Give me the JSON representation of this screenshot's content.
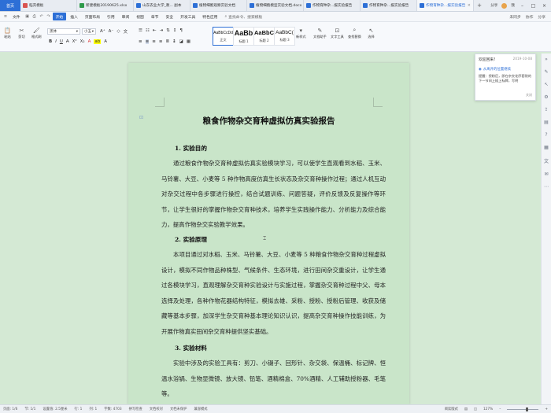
{
  "tabs": {
    "home": "首页",
    "items": [
      {
        "label": "稻壳模板",
        "color": "#d9534f"
      },
      {
        "label": "新建模板20190625.xlsx",
        "color": "#2e9a4a"
      },
      {
        "label": "山东农业大学_教... 副本",
        "color": "#2d6fd6"
      },
      {
        "label": "植物细胞观察实验文档",
        "color": "#2d6fd6"
      },
      {
        "label": "植物细胞模型实验文档.docx",
        "color": "#2d6fd6"
      },
      {
        "label": "作物育种杂...报实验报告",
        "color": "#2d6fd6"
      },
      {
        "label": "作物育种杂...报实验报告",
        "color": "#2d6fd6"
      },
      {
        "label": "作物育种杂...报实验报告",
        "color": "#2d6fd6",
        "active": true
      }
    ],
    "right": [
      "分享",
      "我"
    ]
  },
  "menu": {
    "file": "文件",
    "items": [
      "开始",
      "插入",
      "页面布局",
      "引用",
      "审阅",
      "视图",
      "章节",
      "安全",
      "开发工具",
      "特色应用"
    ],
    "active_index": 0,
    "search": "查找命令、搜索模板",
    "right": [
      "未同步",
      "协作",
      "分享"
    ]
  },
  "ribbon": {
    "paste": "粘贴",
    "cut": "剪切",
    "format_brush": "格式刷",
    "font_name": "黑体",
    "font_size": "小五",
    "styles": [
      {
        "sample": "AaBbCcDd",
        "name": "正文"
      },
      {
        "sample": "AaBb",
        "name": "标题 1"
      },
      {
        "sample": "AaBbC",
        "name": "标题 2"
      },
      {
        "sample": "AaBbC(",
        "name": "标题 3"
      }
    ],
    "new_style": "新样式",
    "text_tools": "文字工具",
    "find_replace": "查找替换",
    "select": "选择",
    "text_assistant": "文档助手",
    "arrange": "选择"
  },
  "document": {
    "title": "粮食作物杂交育种虚拟仿真实验报告",
    "section1_heading": "1. 实验目的",
    "section1_text": "通过粮食作物杂交育种虚拟仿真实验模块学习，可以使学生直观看到水稻、玉米、马铃薯、大豆、小麦等 5 种作物高度仿真生长状态及杂交育种操作过程；通过人机互动对杂交过程中各步骤进行操控，结合试题训练、问题答疑，评价反馈及反复操作等环节，让学生很好的掌握作物杂交育种技术，培养学生实践操作能力、分析能力及综合能力，提高作物杂交实验教学效果。",
    "section2_heading": "2. 实验原理",
    "section2_text": "本项目通过对水稻、玉米、马铃薯、大豆、小麦等 5 种粮食作物杂交育种过程虚拟设计，模拟不同作物品种株型、气候条件、生态环境，进行田间杂交重设计，让学生通过各模块学习，直观理解杂交育种实验设计与实施过程，掌握杂交育种过程中父、母本选择及处理，各种作物花器结构特征，模拟去雄、采粉、授粉、授粉后管理、收获及储藏等基本步骤，加深学生杂交育种基本理论知识认识，提高杂交育种操作技能训练，为开展作物真实田间杂交育种提供坚实基础。",
    "section3_heading": "3. 实验材料",
    "section3_text": "实验中涉及的实验工具有：剪刀、小镊子、回形针、杂交袋、保温桶、标记牌、恒温水浴锅、生物显微镜、放大镜、铅笔、酒精棉盒、70%酒精、人工辅助授粉器、毛笔等。"
  },
  "notification": {
    "title": "欢迎回来!",
    "date": "2019-10-08",
    "subtitle": "从离开的位置继续",
    "body": "提醒：授粉后，即在杂交花序套袋的下一节间上插上标牌，写明",
    "more": "关闭"
  },
  "status": {
    "page": "页面: 1/6",
    "section": "节: 1/1",
    "position": "设置值: 2.5厘米",
    "row": "行: 1",
    "col": "列: 1",
    "words": "字数: 4703",
    "spell": "拼写检查",
    "track": "文档校对",
    "protect": "文档未保护",
    "mode": "兼容模式",
    "zoom": "127%",
    "view": "阅读版式"
  }
}
